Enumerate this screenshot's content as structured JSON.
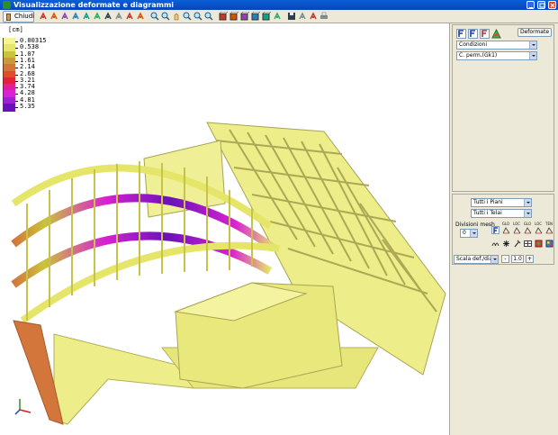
{
  "window": {
    "title": "Visualizzazione deformate e diagrammi"
  },
  "toolbar": {
    "close_label": "Chiudi",
    "icons": [
      "rotate-left-icon",
      "rotate-right-icon",
      "rotate-up-icon",
      "rotate-down-icon",
      "rotate-cw-icon",
      "rotate-ccw-icon",
      "view-front-icon",
      "view-back-icon",
      "view-left-icon",
      "view-right-icon",
      "zoom-window-icon",
      "zoom-in-icon",
      "hand-pan-icon",
      "zoom-extents-icon",
      "zoom-out-icon",
      "zoom-previous-icon",
      "cube-view-1-icon",
      "cube-view-2-icon",
      "cube-view-3-icon",
      "cube-view-4-icon",
      "cube-view-5-icon",
      "render-icon",
      "save-icon",
      "copy-image-icon",
      "export-icon",
      "print-icon"
    ]
  },
  "legend": {
    "unit": "[cm]",
    "entries": [
      {
        "value": "0.00315",
        "color": "#F5F598"
      },
      {
        "value": "0.538",
        "color": "#E5E56A"
      },
      {
        "value": "1.07",
        "color": "#C9C43B"
      },
      {
        "value": "1.61",
        "color": "#C79A3A"
      },
      {
        "value": "2.14",
        "color": "#D2763B"
      },
      {
        "value": "2.68",
        "color": "#DF4B2B"
      },
      {
        "value": "3.21",
        "color": "#E4213A"
      },
      {
        "value": "3.74",
        "color": "#E0209A"
      },
      {
        "value": "4.28",
        "color": "#D922D2"
      },
      {
        "value": "4.81",
        "color": "#A21FD6"
      },
      {
        "value": "5.35",
        "color": "#6A12B8"
      }
    ]
  },
  "panel": {
    "mode_icons": [
      "diagram-n-icon",
      "diagram-m-icon",
      "diagram-h-icon",
      "deformed-shape-icon"
    ],
    "deformate_label": "Deformate",
    "conditions_select": "Condizioni",
    "load_select": "C. perm.(Gk1)",
    "floors_select": "Tutti i Piani",
    "frames_select": "Tutti i Telai",
    "mesh_label": "Divisioni mesh",
    "mesh_value": "0",
    "scale_select": "Scala def./diag.",
    "scale_value": "1.0",
    "option_icons": [
      {
        "name": "font-icon",
        "label": ""
      },
      {
        "name": "glo-x-icon",
        "label": "GLO"
      },
      {
        "name": "loc-x-icon",
        "label": "LOC"
      },
      {
        "name": "glo-y-icon",
        "label": "GLO"
      },
      {
        "name": "loc-y-icon",
        "label": "LOC"
      },
      {
        "name": "tension-icon",
        "label": "TEN"
      }
    ],
    "option_icons2": [
      "spring-icon",
      "asterisk-icon",
      "pin-icon",
      "grid-icon",
      "color-fill-icon",
      "palette-icon"
    ]
  }
}
